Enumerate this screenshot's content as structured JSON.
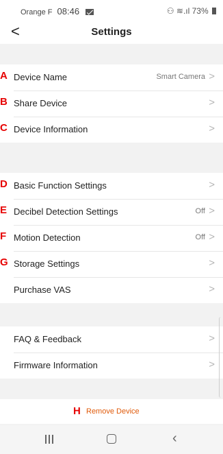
{
  "status": {
    "carrier": "Orange F",
    "time": "08:46",
    "signal_glyph": "⚇ ≋.ıl",
    "battery_percent": "73%"
  },
  "header": {
    "title": "Settings",
    "back_glyph": "<"
  },
  "groups": [
    {
      "items": [
        {
          "marker": "A",
          "label": "Device Name",
          "value": "Smart Camera"
        },
        {
          "marker": "B",
          "label": "Share Device",
          "value": ""
        },
        {
          "marker": "C",
          "label": "Device Information",
          "value": ""
        }
      ]
    },
    {
      "items": [
        {
          "marker": "D",
          "label": "Basic Function Settings",
          "value": ""
        },
        {
          "marker": "E",
          "label": "Decibel Detection Settings",
          "value": "Off"
        },
        {
          "marker": "F",
          "label": "Motion Detection",
          "value": "Off"
        },
        {
          "marker": "G",
          "label": "Storage Settings",
          "value": ""
        },
        {
          "marker": "",
          "label": "Purchase VAS",
          "value": ""
        }
      ]
    },
    {
      "items": [
        {
          "marker": "",
          "label": "FAQ & Feedback",
          "value": ""
        },
        {
          "marker": "",
          "label": "Firmware Information",
          "value": ""
        }
      ]
    }
  ],
  "remove": {
    "marker": "H",
    "label": "Remove Device"
  },
  "chevron_glyph": ">",
  "colors": {
    "marker": "#e60000",
    "remove_text": "#e05a0a",
    "background": "#f2f2f2"
  }
}
